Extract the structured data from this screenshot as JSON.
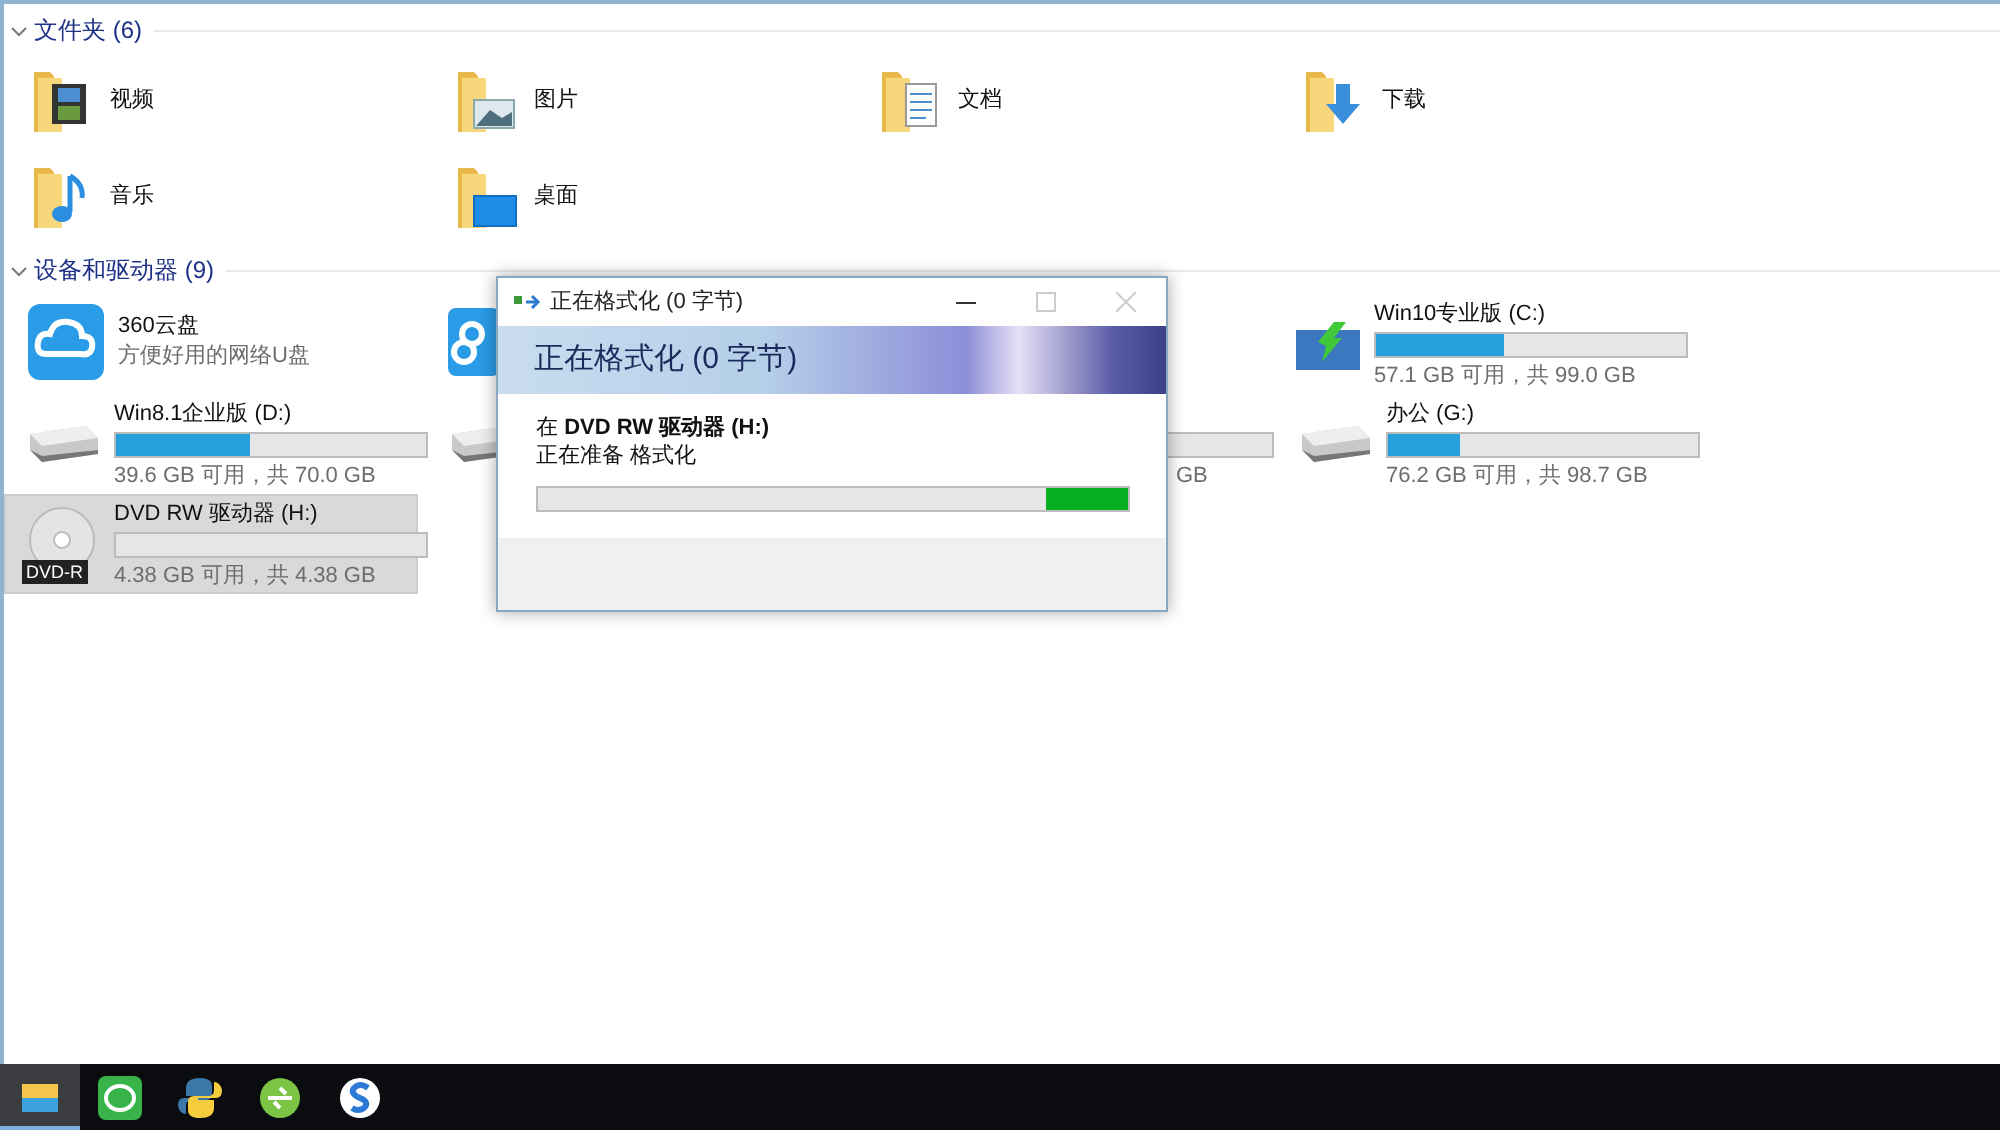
{
  "folders_section": {
    "title": "文件夹 (6)",
    "expanded": true,
    "items": [
      {
        "name": "视频",
        "kind": "video"
      },
      {
        "name": "图片",
        "kind": "picture"
      },
      {
        "name": "文档",
        "kind": "document"
      },
      {
        "name": "下载",
        "kind": "download"
      },
      {
        "name": "音乐",
        "kind": "music"
      },
      {
        "name": "桌面",
        "kind": "desktop"
      }
    ]
  },
  "devices_section": {
    "title": "设备和驱动器 (9)",
    "expanded": true,
    "items": [
      {
        "kind": "cloud",
        "name": "360云盘",
        "subtitle": "方便好用的网络U盘",
        "selected": false
      },
      {
        "kind": "covered-app"
      },
      {
        "kind": "system-drive",
        "name": "Win10专业版 (C:)",
        "level": 0.41,
        "reading": "57.1 GB 可用，共 99.0 GB",
        "selected": false
      },
      {
        "kind": "drive",
        "name": "Win8.1企业版 (D:)",
        "level": 0.43,
        "reading": "39.6 GB 可用，共 70.0 GB",
        "selected": false
      },
      {
        "kind": "covered-drive"
      },
      {
        "kind": "covered-drive-tail",
        "reading": "GB"
      },
      {
        "kind": "drive",
        "name": "办公 (G:)",
        "level": 0.23,
        "reading": "76.2 GB 可用，共 98.7 GB",
        "selected": false
      },
      {
        "kind": "dvd",
        "name": "DVD RW 驱动器 (H:)",
        "badge": "DVD-R",
        "level": 0,
        "reading": "4.38 GB 可用，共 4.38 GB",
        "selected": true
      }
    ]
  },
  "dialog": {
    "title": "正在格式化 (0 字节)",
    "heading": "正在格式化 (0 字节)",
    "target": "在 **DVD RW 驱动器 (H:)**",
    "status": "正在准备 格式化",
    "level": 0.14
  },
  "taskbar": {
    "items": [
      {
        "kind": "explorer",
        "selected": true
      },
      {
        "kind": "chat",
        "selected": false
      },
      {
        "kind": "python",
        "selected": false
      },
      {
        "kind": "green-circle",
        "selected": false
      },
      {
        "kind": "sogou",
        "selected": false
      }
    ]
  }
}
